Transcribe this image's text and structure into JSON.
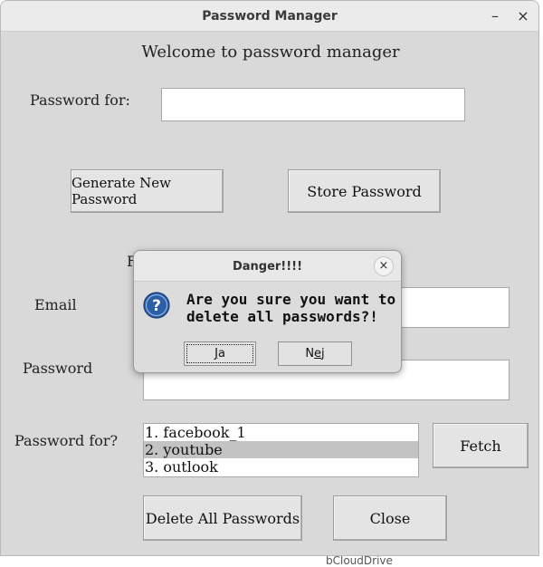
{
  "window": {
    "title": "Password Manager",
    "minimize_glyph": "–",
    "close_glyph": "×"
  },
  "main": {
    "welcome": "Welcome to password manager",
    "password_for_label": "Password for:",
    "password_for_value": "",
    "generate_button": "Generate New Password",
    "store_button": "Store Password",
    "partial_label": "F",
    "email_label": "Email",
    "email_value": "",
    "password_label": "Password",
    "password_value": "",
    "lookup_label": "Password for?",
    "list_items": [
      "1. facebook_1",
      "2. youtube",
      "3. outlook"
    ],
    "selected_index": 1,
    "fetch_button": "Fetch",
    "delete_all_button": "Delete All Passwords",
    "close_button": "Close"
  },
  "dialog": {
    "title": "Danger!!!!",
    "close_glyph": "×",
    "message_line1": "Are you sure you want to",
    "message_line2": "delete all passwords?!",
    "icon": "question-icon",
    "yes_mnemonic": "J",
    "yes_rest": "a",
    "no_first": "N",
    "no_mnemonic": "e",
    "no_rest": "j"
  },
  "background_partial": {
    "text": "bCloudDrive"
  }
}
